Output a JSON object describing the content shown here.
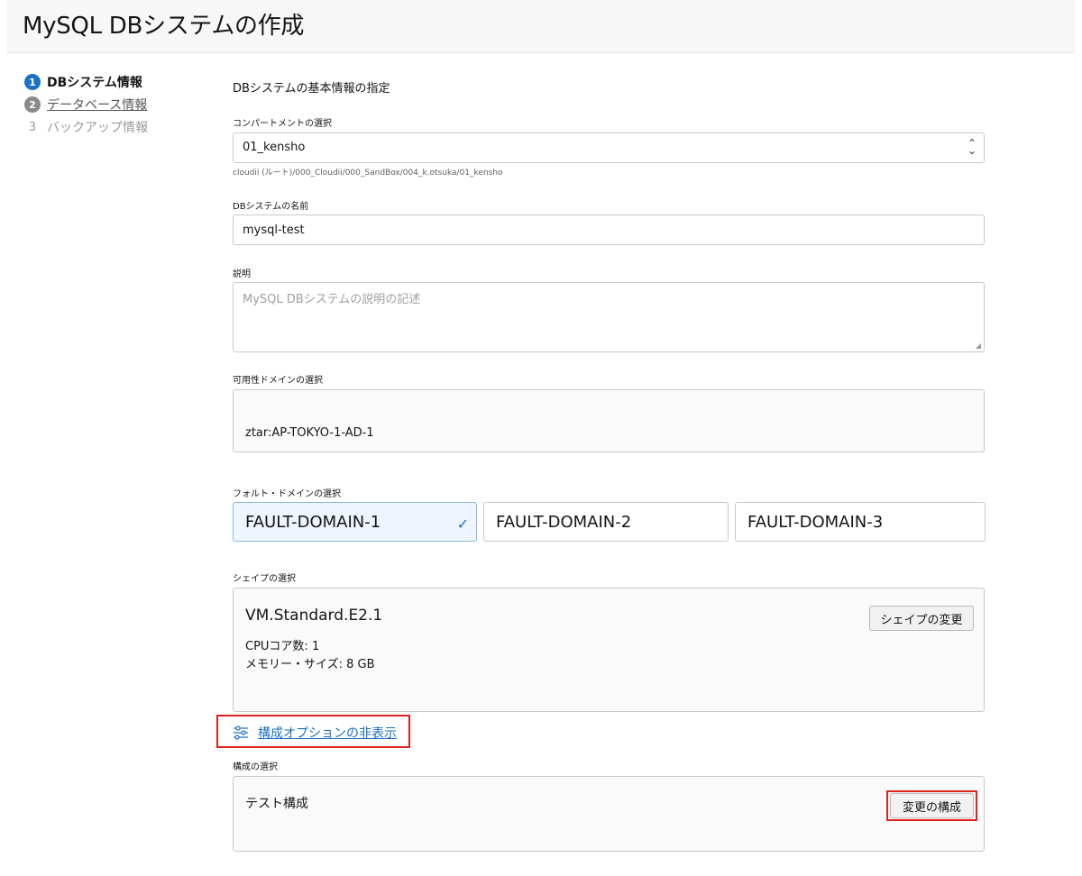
{
  "page": {
    "title": "MySQL DBシステムの作成"
  },
  "steps": [
    {
      "number": "1",
      "label": "DBシステム情報",
      "state": "current"
    },
    {
      "number": "2",
      "label": "データベース情報",
      "state": "link"
    },
    {
      "number": "3",
      "label": "バックアップ情報",
      "state": "disabled"
    }
  ],
  "form": {
    "section_title": "DBシステムの基本情報の指定",
    "compartment": {
      "label": "コンパートメントの選択",
      "value": "01_kensho",
      "path": "cloudii (ルート)/000_Cloudii/000_SandBox/004_k.otsuka/01_kensho"
    },
    "name": {
      "label": "DBシステムの名前",
      "value": "mysql-test"
    },
    "description": {
      "label": "説明",
      "placeholder": "MySQL DBシステムの説明の記述"
    },
    "availability_domain": {
      "label": "可用性ドメインの選択",
      "value": "ztar:AP-TOKYO-1-AD-1"
    },
    "fault_domain": {
      "label": "フォルト・ドメインの選択",
      "options": [
        "FAULT-DOMAIN-1",
        "FAULT-DOMAIN-2",
        "FAULT-DOMAIN-3"
      ],
      "selected": "FAULT-DOMAIN-1"
    },
    "shape": {
      "label": "シェイプの選択",
      "name": "VM.Standard.E2.1",
      "cpu": "CPUコア数: 1",
      "memory": "メモリー・サイズ: 8 GB",
      "change_button": "シェイプの変更"
    },
    "config_toggle": {
      "label": "構成オプションの非表示",
      "icon": "sliders-icon"
    },
    "configuration": {
      "label": "構成の選択",
      "value": "テスト構成",
      "change_button": "変更の構成"
    }
  },
  "colors": {
    "accent": "#1b72c5",
    "highlight": "#e0201c"
  }
}
